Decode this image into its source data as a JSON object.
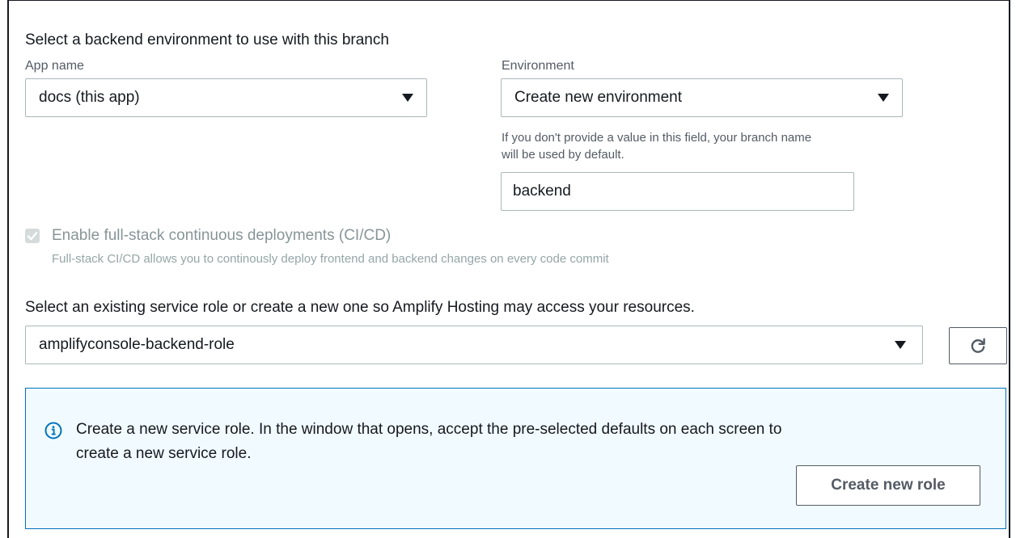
{
  "backend": {
    "heading": "Select a backend environment to use with this branch",
    "app_name_label": "App name",
    "app_name_value": "docs (this app)",
    "environment_label": "Environment",
    "environment_value": "Create new environment",
    "environment_hint": "If you don't provide a value in this field, your branch name will be used by default.",
    "environment_name_value": "backend"
  },
  "cicd": {
    "label": "Enable full-stack continuous deployments (CI/CD)",
    "description": "Full-stack CI/CD allows you to continously deploy frontend and backend changes on every code commit",
    "checked": true,
    "disabled": true
  },
  "service_role": {
    "heading": "Select an existing service role or create a new one so Amplify Hosting may access your resources.",
    "value": "amplifyconsole-backend-role",
    "refresh_icon": "refresh-icon"
  },
  "info": {
    "icon": "info-icon",
    "message": "Create a new service role. In the window that opens, accept the pre-selected defaults on each screen to create a new service role.",
    "button_label": "Create new role"
  },
  "colors": {
    "info_border": "#0073bb",
    "info_background": "#f1faff",
    "disabled_text": "#879596"
  }
}
